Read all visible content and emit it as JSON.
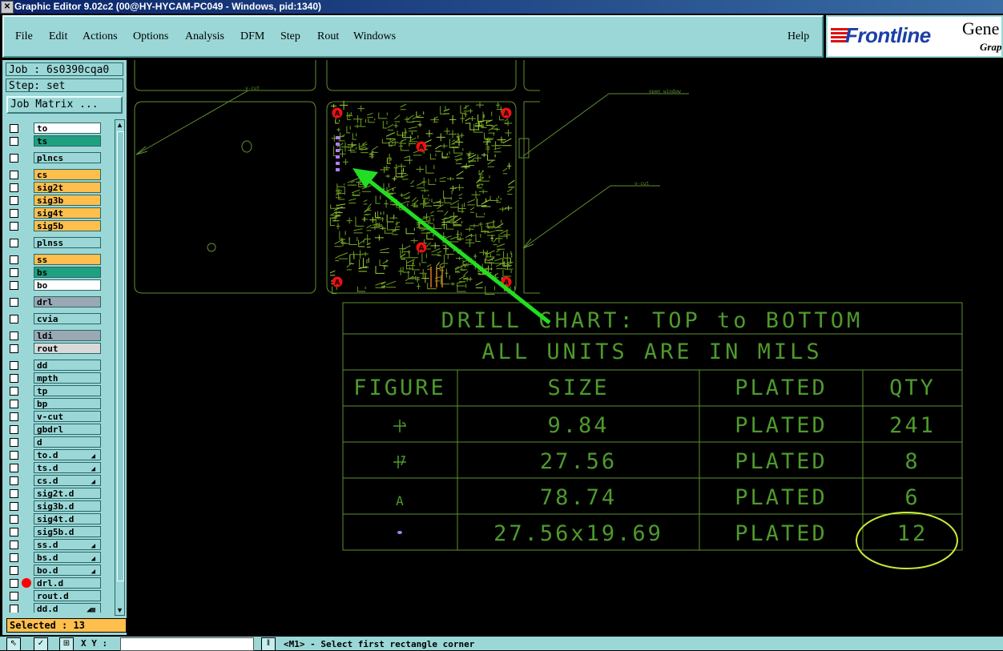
{
  "window": {
    "title": "Graphic Editor 9.02c2 (00@HY-HYCAM-PC049 - Windows, pid:1340)",
    "app_icon": "app-icon"
  },
  "menu": {
    "file": "File",
    "edit": "Edit",
    "actions": "Actions",
    "options": "Options",
    "analysis": "Analysis",
    "dfm": "DFM",
    "step": "Step",
    "rout": "Rout",
    "windows": "Windows",
    "help": "Help"
  },
  "brand": {
    "logo": "Frontline",
    "product": "Gene",
    "subtitle": "Grap"
  },
  "job": {
    "job_label": "Job : 6s0390cqa0",
    "step_label": "Step: set",
    "matrix_button": "Job Matrix ..."
  },
  "layers": [
    {
      "name": "to",
      "color": "#ffffff"
    },
    {
      "name": "ts",
      "color": "#1fa07f"
    },
    {
      "name": "plncs",
      "color": "#9bd7d7"
    },
    {
      "name": "cs",
      "color": "#ffbf4d"
    },
    {
      "name": "sig2t",
      "color": "#ffbf4d"
    },
    {
      "name": "sig3b",
      "color": "#ffbf4d"
    },
    {
      "name": "sig4t",
      "color": "#ffbf4d"
    },
    {
      "name": "sig5b",
      "color": "#ffbf4d"
    },
    {
      "name": "plnss",
      "color": "#9bd7d7"
    },
    {
      "name": "ss",
      "color": "#ffbf4d"
    },
    {
      "name": "bs",
      "color": "#1fa07f"
    },
    {
      "name": "bo",
      "color": "#ffffff"
    },
    {
      "name": "drl",
      "color": "#9aa8b3"
    },
    {
      "name": "cvia",
      "color": "#9bd7d7"
    },
    {
      "name": "ldi",
      "color": "#9aa8b3"
    },
    {
      "name": "rout",
      "color": "#d9d9d9"
    },
    {
      "name": "dd",
      "color": "#9bd7d7"
    },
    {
      "name": "mpth",
      "color": "#9bd7d7"
    },
    {
      "name": "tp",
      "color": "#9bd7d7"
    },
    {
      "name": "bp",
      "color": "#9bd7d7"
    },
    {
      "name": "v-cut",
      "color": "#9bd7d7"
    },
    {
      "name": "gbdrl",
      "color": "#9bd7d7"
    },
    {
      "name": "d",
      "color": "#9bd7d7"
    },
    {
      "name": "to.d",
      "color": "#9bd7d7",
      "mark": "◢"
    },
    {
      "name": "ts.d",
      "color": "#9bd7d7",
      "mark": "◢"
    },
    {
      "name": "cs.d",
      "color": "#9bd7d7",
      "mark": "◢"
    },
    {
      "name": "sig2t.d",
      "color": "#9bd7d7"
    },
    {
      "name": "sig3b.d",
      "color": "#9bd7d7"
    },
    {
      "name": "sig4t.d",
      "color": "#9bd7d7"
    },
    {
      "name": "sig5b.d",
      "color": "#9bd7d7"
    },
    {
      "name": "ss.d",
      "color": "#9bd7d7",
      "mark": "◢"
    },
    {
      "name": "bs.d",
      "color": "#9bd7d7",
      "mark": "◢"
    },
    {
      "name": "bo.d",
      "color": "#9bd7d7",
      "mark": "◢"
    },
    {
      "name": "drl.d",
      "color": "#9bd7d7",
      "dot": true
    },
    {
      "name": "rout.d",
      "color": "#9bd7d7"
    },
    {
      "name": "dd.d",
      "color": "#9bd7d7",
      "mark": "◢▦"
    }
  ],
  "selected": "Selected : 13",
  "status": {
    "xy_label": "X Y :",
    "message": "<M1> - Select first rectangle corner"
  },
  "drawing": {
    "vcut_label": "v-cut",
    "open_window_label": "open_window",
    "chart_title": "DRILL CHART: TOP to BOTTOM",
    "chart_units": "ALL UNITS ARE IN MILS",
    "headers": [
      "FIGURE",
      "SIZE",
      "PLATED",
      "QTY"
    ],
    "rows": [
      {
        "size": "9.84",
        "plated": "PLATED",
        "qty": "241"
      },
      {
        "size": "27.56",
        "plated": "PLATED",
        "qty": "8"
      },
      {
        "size": "78.74",
        "plated": "PLATED",
        "qty": "6"
      },
      {
        "size": "27.56x19.69",
        "plated": "PLATED",
        "qty": "12"
      }
    ],
    "red_marker": "A",
    "figure_a": "A"
  },
  "colors": {
    "cad_line": "#5f8f2f",
    "cad_text": "#4e9a2c",
    "arrow": "#22dd22",
    "highlight": "#c9ea3a",
    "slot": "#b07cff",
    "marker": "#ee1111"
  }
}
